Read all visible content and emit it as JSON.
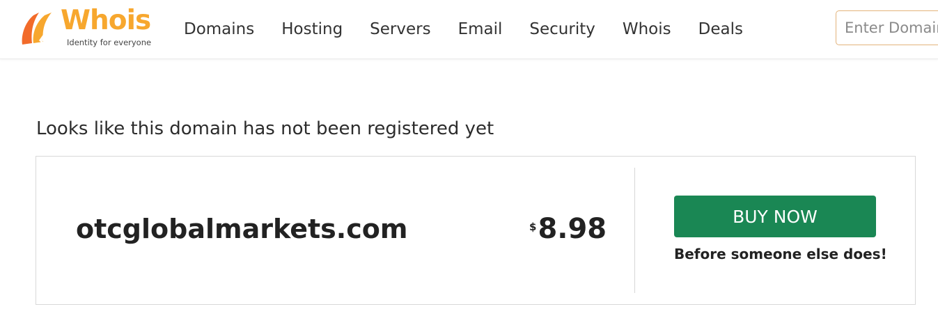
{
  "header": {
    "logo": {
      "word": "Whois",
      "tagline": "Identity for everyone"
    },
    "nav": [
      {
        "label": "Domains"
      },
      {
        "label": "Hosting"
      },
      {
        "label": "Servers"
      },
      {
        "label": "Email"
      },
      {
        "label": "Security"
      },
      {
        "label": "Whois"
      },
      {
        "label": "Deals"
      }
    ],
    "search": {
      "placeholder": "Enter Domain",
      "value": ""
    }
  },
  "main": {
    "status": "Looks like this domain has not been registered yet",
    "domain": "otcglobalmarkets.com",
    "price": {
      "currency": "$",
      "amount": "8.98"
    },
    "buy_label": "BUY NOW",
    "buy_subtext": "Before someone else does!"
  },
  "colors": {
    "brand_orange": "#f7a72e",
    "logo_mark_orange": "#f26b2a",
    "buy_green": "#1a8754",
    "search_border": "#e3b37b"
  },
  "icons": {
    "logo_mark": "whois-logo-mark-icon"
  }
}
